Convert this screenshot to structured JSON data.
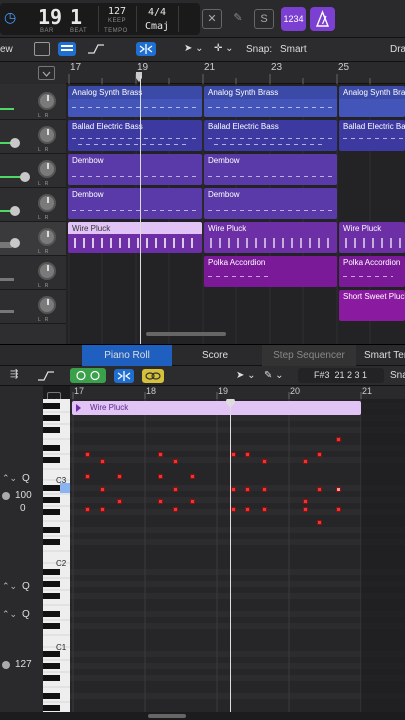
{
  "lcd": {
    "bar": "19",
    "beat": "1",
    "bar_cap": "BAR",
    "beat_cap": "BEAT",
    "tempo": "127",
    "keep": "KEEP",
    "tempo_cap": "TEMPO",
    "sig": "4/4",
    "key": "Cmaj"
  },
  "count_in": "1234",
  "tracks_toolbar": {
    "view": "ew",
    "snap_label": "Snap:",
    "snap_value": "Smart",
    "drag_label": "Dra"
  },
  "ruler_bars": [
    "17",
    "19",
    "21",
    "23",
    "25"
  ],
  "regions": [
    {
      "name": "Analog Synth Brass",
      "color": "#3b4aa6"
    },
    {
      "name": "Analog Synth Brass",
      "color": "#3b4aa6"
    },
    {
      "name": "Analog Synth Brass",
      "color": "#3b4aa6"
    },
    {
      "name": "Ballad Electric Bass",
      "color": "#3c3aa0"
    },
    {
      "name": "Ballad Electric Bass",
      "color": "#3c3aa0"
    },
    {
      "name": "Ballad Electric Bass",
      "color": "#3c3aa0"
    },
    {
      "name": "Dembow",
      "color": "#5a3aa8"
    },
    {
      "name": "Dembow",
      "color": "#5a3aa8"
    },
    {
      "name": "Dembow",
      "color": "#5a3aa8"
    },
    {
      "name": "Dembow",
      "color": "#5a3aa8"
    },
    {
      "name": "Wire Pluck",
      "color": "#e2c3f5"
    },
    {
      "name": "Wire Pluck",
      "color": "#6d2fa6"
    },
    {
      "name": "Wire Pluck",
      "color": "#6d2fa6"
    },
    {
      "name": "Polka Accordion",
      "color": "#7a1a99"
    },
    {
      "name": "Polka Accordion",
      "color": "#7a1a99"
    },
    {
      "name": "Short Sweet Pluck",
      "color": "#8a1aa0"
    }
  ],
  "tabs": {
    "piano_roll": "Piano Roll",
    "score": "Score",
    "step_seq": "Step Sequencer",
    "smart_tempo": "Smart Tem"
  },
  "piano_toolbar": {
    "position": "F#3  21 2 3 1",
    "snap": "Snap"
  },
  "piano_ruler": [
    "17",
    "18",
    "19",
    "20",
    "21"
  ],
  "piano_region": "Wire Pluck",
  "key_labels": {
    "c3": "C3",
    "c2": "C2",
    "c1": "C1"
  },
  "left_panel": {
    "q1": "Q",
    "velocity": "100",
    "zero": "0",
    "q2": "Q",
    "q3": "Q",
    "v127": "127"
  },
  "colors": {
    "accent_purple": "#7b3fd1",
    "accent_blue": "#1f6fd1",
    "note_red": "#e5383b"
  }
}
